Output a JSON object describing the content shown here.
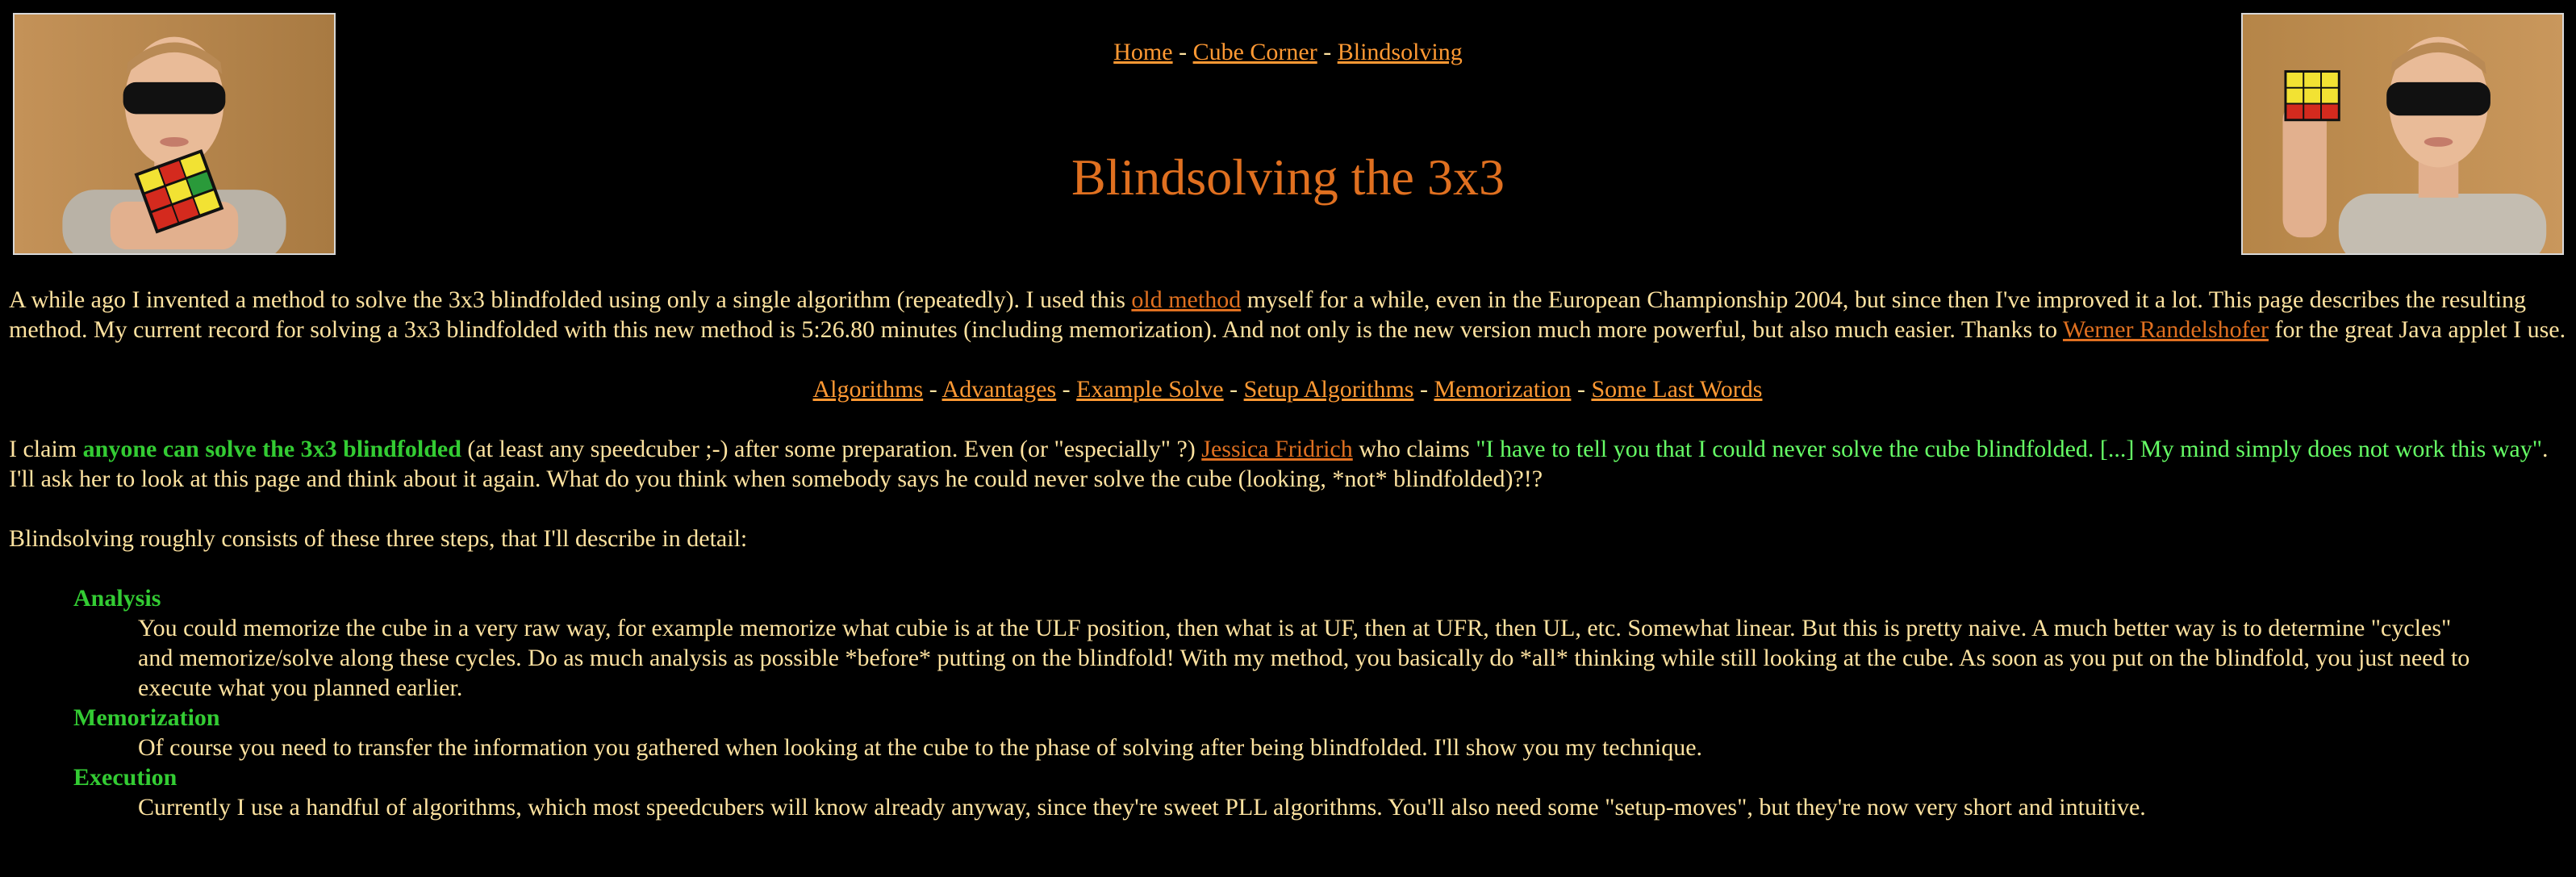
{
  "nav": {
    "home": "Home",
    "sep1": " - ",
    "cube_corner": "Cube Corner",
    "sep2": " - ",
    "blindsolving": "Blindsolving"
  },
  "title": "Blindsolving the 3x3",
  "intro": {
    "t1": "A while ago I invented a method to solve the 3x3 blindfolded using only a single algorithm (repeatedly). I used this ",
    "link_old_method": "old method",
    "t2": " myself for a while, even in the European Championship 2004, but since then I've improved it a lot. This page describes the resulting method. My current record for solving a 3x3 blindfolded with this new method is 5:26.80 minutes (including memorization). And not only is the new version much more powerful, but also much easier. Thanks to ",
    "link_werner": "Werner Randelshofer",
    "t3": " for the great Java applet I use."
  },
  "toc": {
    "items": [
      "Algorithms",
      "Advantages",
      "Example Solve",
      "Setup Algorithms",
      "Memorization",
      "Some Last Words"
    ],
    "separator": " - "
  },
  "claim": {
    "t1": "I claim ",
    "bold": "anyone can solve the 3x3 blindfolded",
    "t2": " (at least any speedcuber ;-) after some preparation. Even (or \"especially\" ?) ",
    "link_jessica": "Jessica Fridrich",
    "t3": " who claims ",
    "quote": "\"I have to tell you that I could never solve the cube blindfolded. [...] My mind simply does not work this way\"",
    "t4": ". I'll ask her to look at this page and think about it again. What do you think when somebody says he could never solve the cube (looking, *not* blindfolded)?!?"
  },
  "steps_intro": "Blindsolving roughly consists of these three steps, that I'll describe in detail:",
  "steps": [
    {
      "term": "Analysis",
      "desc": "You could memorize the cube in a very raw way, for example memorize what cubie is at the ULF position, then what is at UF, then at UFR, then UL, etc. Somewhat linear. But this is pretty naive. A much better way is to determine \"cycles\" and memorize/solve along these cycles. Do as much analysis as possible *before* putting on the blindfold! With my method, you basically do *all* thinking while still looking at the cube. As soon as you put on the blindfold, you just need to execute what you planned earlier."
    },
    {
      "term": "Memorization",
      "desc": "Of course you need to transfer the information you gathered when looking at the cube to the phase of solving after being blindfolded. I'll show you my technique."
    },
    {
      "term": "Execution",
      "desc": "Currently I use a handful of algorithms, which most speedcubers will know already anyway, since they're sweet PLL algorithms. You'll also need some \"setup-moves\", but they're now very short and intuitive."
    }
  ],
  "colors": {
    "background": "#000000",
    "text": "#ffe3a0",
    "link": "#ff9933",
    "title": "#e07020",
    "highlight_green": "#33cc33",
    "quote_green": "#66ff66"
  }
}
